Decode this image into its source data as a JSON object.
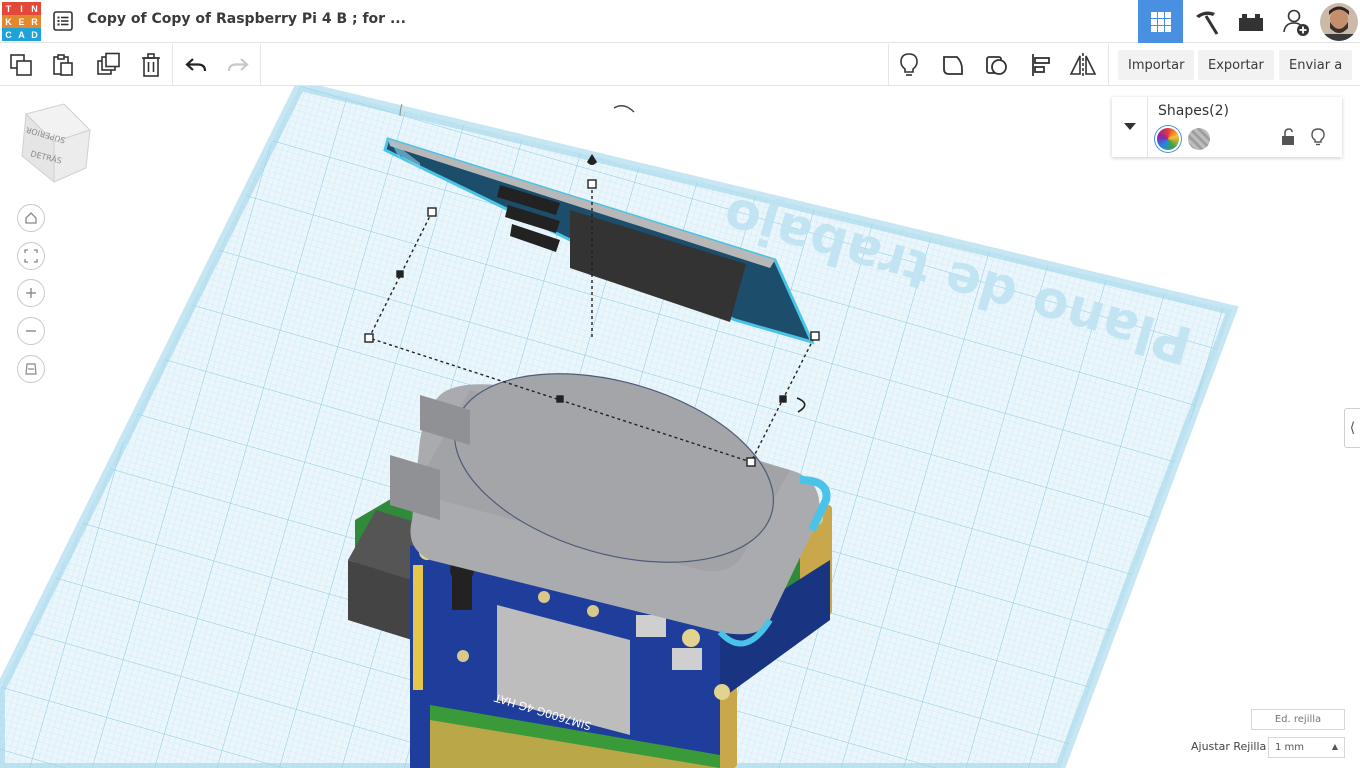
{
  "app": {
    "logo_letters": [
      "T",
      "I",
      "N",
      "K",
      "E",
      "R",
      "C",
      "A",
      "D"
    ],
    "logo_colors": [
      "#e2493b",
      "#e2493b",
      "#e2493b",
      "#e2882d",
      "#e2882d",
      "#e2882d",
      "#1fa2d8",
      "#1fa2d8",
      "#1fa2d8"
    ],
    "doc_title": "Copy of Copy of Raspberry Pi 4 B ; for ...",
    "header_icons": [
      "grid-view-icon",
      "pickaxe-icon",
      "bricks-icon",
      "add-user-icon"
    ]
  },
  "toolbar": {
    "import_label": "Importar",
    "export_label": "Exportar",
    "send_label": "Enviar a"
  },
  "viewcube": {
    "top_label": "SUPERIOR",
    "back_label": "DETRÁS"
  },
  "workplane": {
    "label": "Plano de trabajo",
    "grid_color": "#bfe3ef",
    "accent": "#49c3e8"
  },
  "inspector": {
    "title": "Shapes(2)"
  },
  "hat_label": "SIM7600G 4G HAT",
  "grid_controls": {
    "edit_grid_label": "Ed. rejilla",
    "snap_label": "Ajustar Rejilla",
    "snap_value": "1 mm"
  },
  "colors": {
    "accent_blue": "#4a90e2",
    "board_blue": "#1f3e9c",
    "hat_green": "#2f8a3a"
  }
}
